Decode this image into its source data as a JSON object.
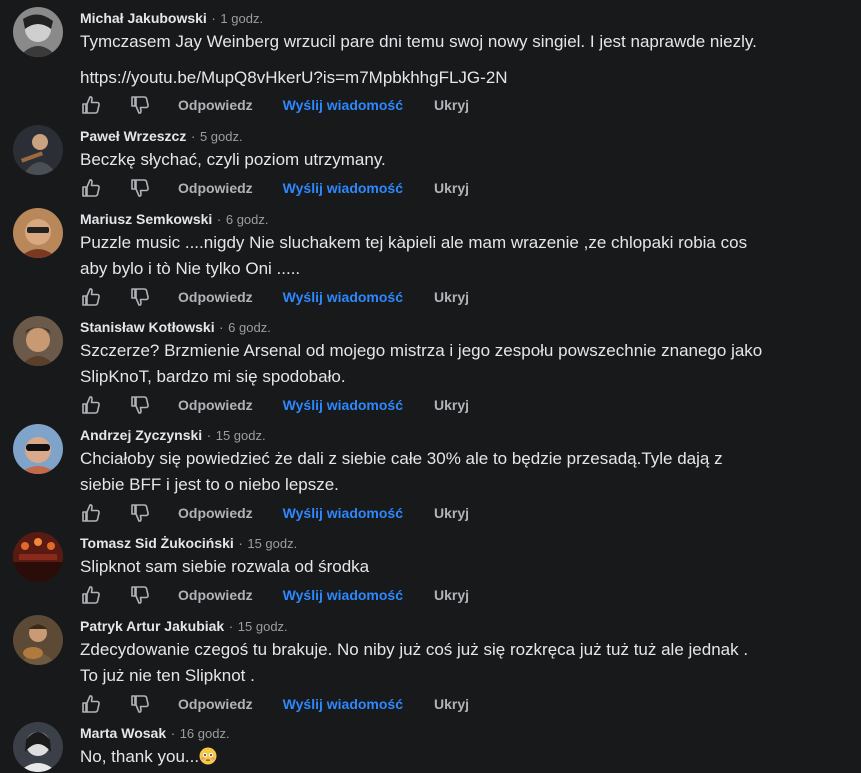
{
  "labels": {
    "reply": "Odpowiedz",
    "message": "Wyślij wiadomość",
    "hide": "Ukryj",
    "separator": "·"
  },
  "colors": {
    "background": "#18191a",
    "author": "#e4e6eb",
    "meta": "#9a9da2",
    "link_action": "#2d88ff"
  },
  "comments": [
    {
      "author": "Michał Jakubowski",
      "time": "1 godz.",
      "lines": [
        "Tymczasem Jay Weinberg wrzucil pare dni temu swoj nowy singiel. I jest naprawde niezly."
      ],
      "link": "https://youtu.be/MupQ8vHkerU?is=m7MpbkhhgFLJG-2N"
    },
    {
      "author": "Paweł Wrzeszcz",
      "time": "5 godz.",
      "lines": [
        "Beczkę słychać, czyli poziom utrzymany."
      ]
    },
    {
      "author": "Mariusz Semkowski",
      "time": "6 godz.",
      "lines": [
        "Puzzle music ....nigdy Nie sluchakem tej kàpieli ale mam wrazenie ,ze chlopaki robia cos",
        "aby bylo i tò Nie tylko Oni ....."
      ]
    },
    {
      "author": "Stanisław Kotłowski",
      "time": "6 godz.",
      "lines": [
        "Szczerze? Brzmienie Arsenal od mojego mistrza i jego zespołu powszechnie znanego jako",
        "SlipKnoT, bardzo mi się spodobało."
      ]
    },
    {
      "author": "Andrzej Zyczynski",
      "time": "15 godz.",
      "lines": [
        "Chciałoby się powiedzieć że dali z siebie całe 30% ale to będzie przesadą.Tyle dają z",
        "siebie BFF i jest to o niebo lepsze."
      ]
    },
    {
      "author": "Tomasz Sid Żukociński",
      "time": "15 godz.",
      "lines": [
        "Slipknot sam siebie rozwala od środka"
      ]
    },
    {
      "author": "Patryk Artur Jakubiak",
      "time": "15 godz.",
      "lines": [
        "Zdecydowanie czegoś tu brakuje. No niby już coś już się rozkręca już tuż tuż ale jednak .",
        "To już nie ten Slipknot ."
      ]
    },
    {
      "author": "Marta Wosak",
      "time": "16 godz.",
      "lines": [
        "No, thank you..."
      ],
      "emoji": "flushed-face-emoji"
    }
  ]
}
